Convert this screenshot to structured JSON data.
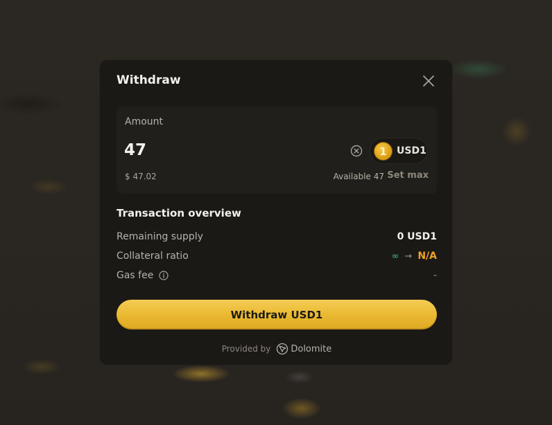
{
  "modal": {
    "title": "Withdraw"
  },
  "amount": {
    "label": "Amount",
    "value": "47",
    "usd_value": "$ 47.02",
    "available": "Available 47",
    "set_max_label": "Set max"
  },
  "token": {
    "symbol": "USD1",
    "logo_text": "1",
    "logo_color": "#E9B22C"
  },
  "overview": {
    "title": "Transaction overview",
    "rows": [
      {
        "label": "Remaining supply",
        "value": "0 USD1"
      },
      {
        "label": "Collateral ratio",
        "from": "∞",
        "arrow": "→",
        "to": "N/A"
      },
      {
        "label": "Gas fee",
        "value": "-"
      }
    ]
  },
  "actions": {
    "withdraw_label": "Withdraw USD1"
  },
  "footer": {
    "provided_by": "Provided by",
    "provider_name": "Dolomite"
  },
  "colors": {
    "accent": "#EDBE3A",
    "positive": "#3BC58B",
    "warning": "#F0A12A",
    "modal_bg": "#1B1916"
  }
}
